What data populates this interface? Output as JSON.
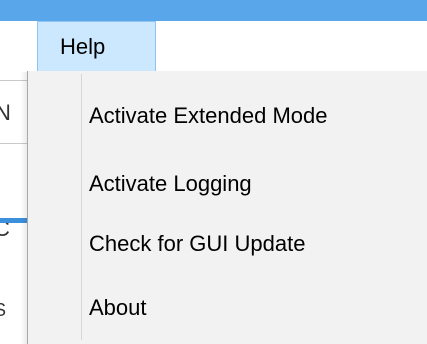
{
  "menubar": {
    "help_label": "Help"
  },
  "help_menu": {
    "items": [
      {
        "label": "Activate Extended Mode"
      },
      {
        "label": "Activate Logging"
      },
      {
        "label": "Check for GUI Update"
      },
      {
        "label": "About"
      }
    ]
  },
  "background": {
    "glyphs": [
      "N",
      "C",
      "S"
    ]
  },
  "colors": {
    "title_strip": "#5aa6ea",
    "menu_highlight": "#cce8ff",
    "menu_highlight_border": "#8ec4f2",
    "dropdown_bg": "#f2f2f2"
  }
}
